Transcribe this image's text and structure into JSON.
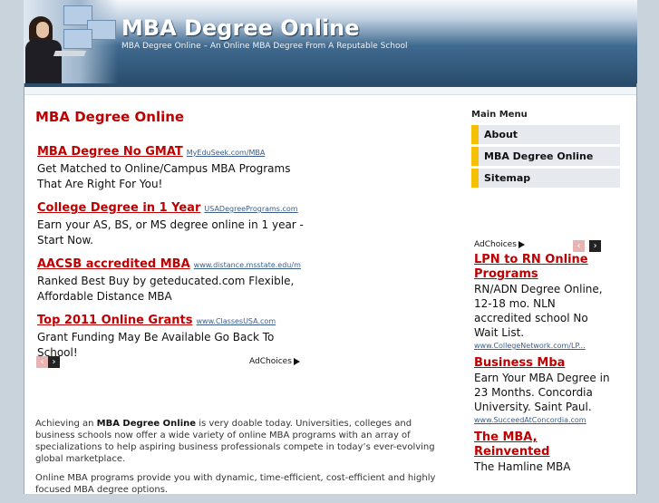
{
  "header": {
    "title": "MBA Degree Online",
    "tagline": "MBA Degree Online – An Online MBA Degree From A Reputable School"
  },
  "main": {
    "heading": "MBA Degree Online",
    "ads": [
      {
        "title": "MBA Degree No GMAT",
        "url": "MyEduSeek.com/MBA",
        "desc": "Get Matched to Online/Campus MBA Programs That Are Right For You!"
      },
      {
        "title": "College Degree in 1 Year",
        "url": "USADegreePrograms.com",
        "desc": "Earn your AS, BS, or MS degree online in 1 year - Start Now."
      },
      {
        "title": "AACSB accredited MBA",
        "url": "www.distance.msstate.edu/m",
        "desc": "Ranked Best Buy by geteducated.com Flexible, Affordable Distance MBA"
      },
      {
        "title": "Top 2011 Online Grants",
        "url": "www.ClassesUSA.com",
        "desc": "Grant Funding May Be Available Go Back To School!"
      }
    ],
    "adchoices": "AdChoices",
    "nav_prev": "‹",
    "nav_next": "›",
    "p1_a": "Achieving an ",
    "p1_b": "MBA Degree Online",
    "p1_c": " is very doable today. Universities, colleges and business schools now offer a wide variety of online MBA programs with an array of specializations to help aspiring business professionals compete in today’s ever-evolving global marketplace.",
    "p2": "Online MBA programs provide you with dynamic, time-efficient, cost-efficient and highly focused MBA degree options."
  },
  "sidebar": {
    "menu_title": "Main Menu",
    "items": [
      "About",
      "MBA Degree Online",
      "Sitemap"
    ],
    "adchoices": "AdChoices",
    "ads": [
      {
        "title": "LPN to RN Online Programs",
        "desc": "RN/ADN Degree Online, 12-18 mo. NLN accredited school No Wait List.",
        "url": "www.CollegeNetwork.com/LP..."
      },
      {
        "title": "Business Mba",
        "desc": "Earn Your MBA Degree in 23 Months. Concordia University. Saint Paul.",
        "url": "www.SucceedAtConcordia.com"
      },
      {
        "title": "The MBA, Reinvented",
        "desc": "The Hamline MBA",
        "url": ""
      }
    ]
  }
}
